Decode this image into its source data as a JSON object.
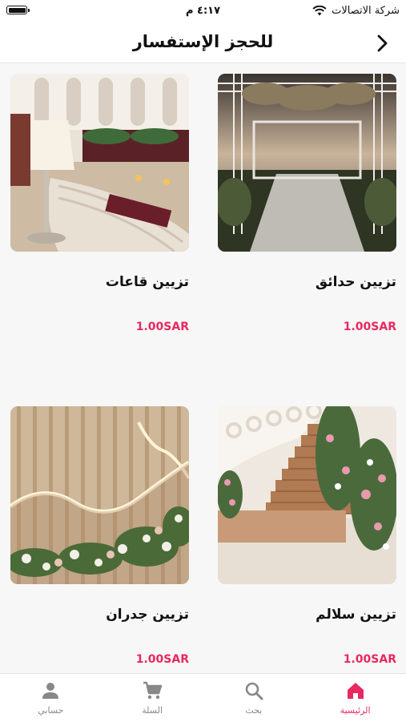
{
  "status_bar": {
    "carrier": "شركة الاتصالات",
    "time": "٤:١٧ م"
  },
  "header": {
    "title": "للحجز الإستفسار",
    "back_icon": "chevron-right-icon"
  },
  "products": [
    {
      "name": "تزيين حدائق",
      "price": "1.00SAR",
      "image": "garden-decor-photo"
    },
    {
      "name": "تزيين قاعات",
      "price": "1.00SAR",
      "image": "hall-decor-photo"
    },
    {
      "name": "تزيين سلالم",
      "price": "1.00SAR",
      "image": "stairs-decor-photo"
    },
    {
      "name": "تزيين جدران",
      "price": "1.00SAR",
      "image": "walls-decor-photo"
    }
  ],
  "tab_bar": {
    "items": [
      {
        "label": "الرئيسية",
        "icon": "home-icon",
        "active": true
      },
      {
        "label": "بحث",
        "icon": "search-icon",
        "active": false
      },
      {
        "label": "السلة",
        "icon": "cart-icon",
        "active": false
      },
      {
        "label": "حسابي",
        "icon": "user-icon",
        "active": false
      }
    ]
  },
  "colors": {
    "accent": "#e8285f",
    "inactive": "#888888",
    "background": "#f7f7f7"
  }
}
